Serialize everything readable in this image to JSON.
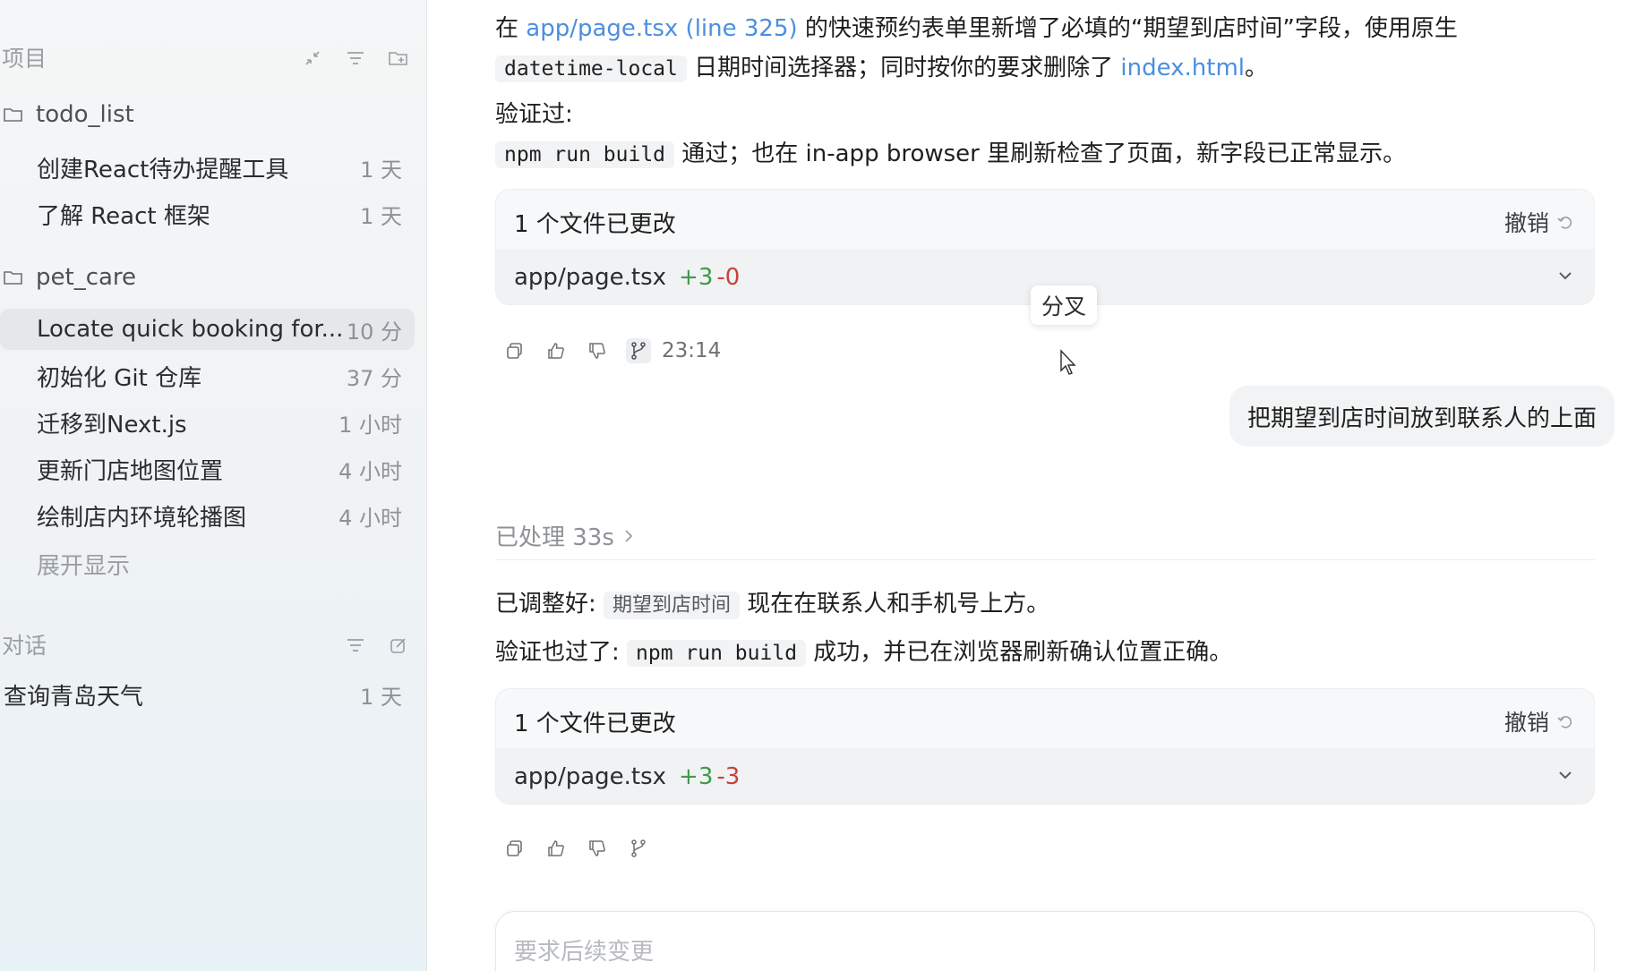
{
  "sidebar": {
    "projects_title": "项目",
    "folders": [
      {
        "name": "todo_list",
        "threads": [
          {
            "title": "创建React待办提醒工具",
            "time": "1 天"
          },
          {
            "title": "了解 React 框架",
            "time": "1 天"
          }
        ]
      },
      {
        "name": "pet_care",
        "threads": [
          {
            "title": "Locate quick booking for...",
            "time": "10 分"
          },
          {
            "title": "初始化 Git 仓库",
            "time": "37 分"
          },
          {
            "title": "迁移到Next.js",
            "time": "1 小时"
          },
          {
            "title": "更新门店地图位置",
            "time": "4 小时"
          },
          {
            "title": "绘制店内环境轮播图",
            "time": "4 小时"
          }
        ],
        "expand_label": "展开显示"
      }
    ],
    "conversations_title": "对话",
    "conversations": [
      {
        "title": "查询青岛天气",
        "time": "1 天"
      }
    ]
  },
  "main": {
    "msg1": {
      "p1_pre": "在 ",
      "p1_link": "app/page.tsx (line 325)",
      "p1_post": " 的快速预约表单里新增了必填的“期望到店时间”字段，使用原生",
      "p2_code": "datetime-local",
      "p2_mid": " 日期时间选择器；同时按你的要求删除了 ",
      "p2_link": "index.html",
      "p2_end": "。",
      "verified_label": "验证过:",
      "p4_code": "npm run build",
      "p4_text": " 通过；也在 in-app browser 里刷新检查了页面，新字段已正常显示。"
    },
    "card1": {
      "title": "1 个文件已更改",
      "undo": "撤销",
      "file": "app/page.tsx",
      "additions": "+3",
      "deletions": "-0"
    },
    "tooltip": "分叉",
    "msg1_time": "23:14",
    "user_message": "把期望到店时间放到联系人的上面",
    "processed": "已处理 33s",
    "msg2": {
      "p1_pre": "已调整好:",
      "p1_chip": "期望到店时间",
      "p1_post": " 现在在联系人和手机号上方。",
      "p2_pre": "验证也过了:",
      "p2_code": "npm run build",
      "p2_post": " 成功，并已在浏览器刷新确认位置正确。"
    },
    "card2": {
      "title": "1 个文件已更改",
      "undo": "撤销",
      "file": "app/page.tsx",
      "additions": "+3",
      "deletions": "-3"
    },
    "composer_placeholder": "要求后续变更"
  }
}
